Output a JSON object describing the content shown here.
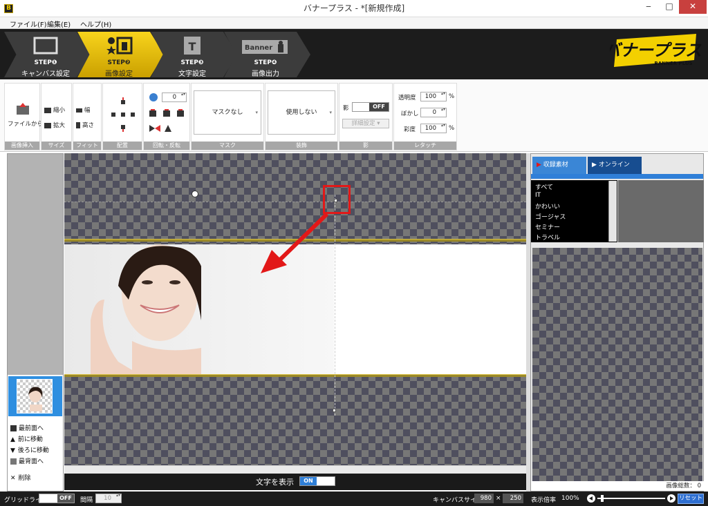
{
  "window": {
    "app_icon": "B",
    "title": "バナープラス - *[新規作成]",
    "minimize": "‒",
    "maximize": "□",
    "close": "✕"
  },
  "menu": [
    "ファイル(F)",
    "編集(E)",
    "ヘルプ(H)"
  ],
  "steps": [
    {
      "num": "STEP❶",
      "label": "キャンバス設定",
      "active": false,
      "icon": "canvas-icon"
    },
    {
      "num": "STEP❷",
      "label": "画像設定",
      "active": true,
      "icon": "image-icon"
    },
    {
      "num": "STEP❸",
      "label": "文字設定",
      "active": false,
      "icon": "text-icon"
    },
    {
      "num": "STEP❹",
      "label": "画像出力",
      "active": false,
      "icon": "banner-icon",
      "icon_text": "Banner"
    }
  ],
  "logo": {
    "main": "バナープラス",
    "sub": "BANNER PLUS",
    "accent": "#f3d000"
  },
  "ribbon": {
    "insert": {
      "from_file": "ファイルから",
      "label": "画像挿入"
    },
    "size": {
      "shrink": "縮小",
      "enlarge": "拡大",
      "label": "サイズ"
    },
    "fit": {
      "width": "幅",
      "height": "高さ",
      "label": "フィット"
    },
    "arrange": {
      "label": "配置"
    },
    "rotate": {
      "angle": "0",
      "label": "回転・反転"
    },
    "mask": {
      "value": "マスクなし",
      "label": "マスク"
    },
    "decor": {
      "value": "使用しない",
      "label": "装飾"
    },
    "shadow": {
      "prefix": "影",
      "toggle": "OFF",
      "detail": "詳細設定",
      "label": "影"
    },
    "retouch": {
      "opacity_label": "透明度",
      "opacity": "100",
      "opacity_unit": "%",
      "blur_label": "ぼかし",
      "blur": "0",
      "saturation_label": "彩度",
      "saturation": "100",
      "saturation_unit": "%",
      "label": "レタッチ"
    }
  },
  "layers": {
    "bring_front": "最前面へ",
    "forward": "前に移動",
    "backward": "後ろに移動",
    "send_back": "最背面へ",
    "delete": "削除"
  },
  "canvas": {
    "show_text_label": "文字を表示",
    "show_text_toggle": "ON"
  },
  "assets": {
    "tab_recorded": "収録素材",
    "tab_online": "オンライン",
    "categories": [
      "すべて",
      "IT",
      "かわいい",
      "ゴージャス",
      "セミナー",
      "トラベル"
    ],
    "count_label": "画像総数：",
    "count": "0"
  },
  "status": {
    "grid_label": "グリッドライン",
    "grid_toggle": "OFF",
    "interval_label": "間隔",
    "interval": "10",
    "canvas_size_label": "キャンバスサイズ",
    "width": "980",
    "times": "×",
    "height": "250",
    "zoom_label": "表示倍率",
    "zoom": "100%",
    "reset": "リセット"
  },
  "colors": {
    "accent_blue": "#2f8fe0",
    "active_step": "#f3c400",
    "highlight_red": "#e21818"
  }
}
